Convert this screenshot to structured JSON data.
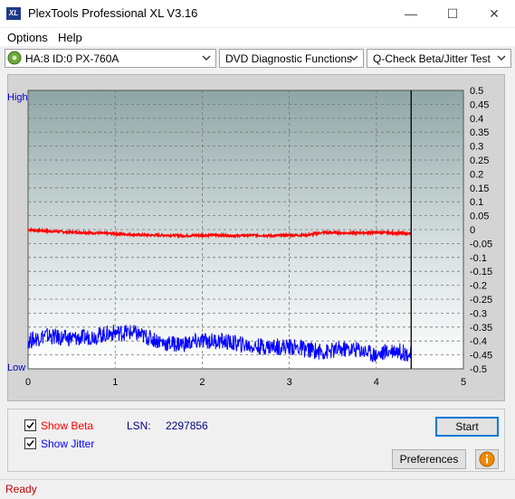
{
  "window": {
    "title": "PlexTools Professional XL V3.16",
    "icon_label": "XL"
  },
  "menu": [
    {
      "label": "Options"
    },
    {
      "label": "Help"
    }
  ],
  "toolbar": {
    "drive": "HA:8 ID:0  PX-760A",
    "function": "DVD Diagnostic Functions",
    "test": "Q-Check Beta/Jitter Test"
  },
  "chart": {
    "left_high": "High",
    "left_low": "Low",
    "x_ticks": [
      "0",
      "1",
      "2",
      "3",
      "4",
      "5"
    ],
    "right_ticks": [
      "0.5",
      "0.45",
      "0.4",
      "0.35",
      "0.3",
      "0.25",
      "0.2",
      "0.15",
      "0.1",
      "0.05",
      "0",
      "-0.05",
      "-0.1",
      "-0.15",
      "-0.2",
      "-0.25",
      "-0.3",
      "-0.35",
      "-0.4",
      "-0.45",
      "-0.5"
    ]
  },
  "chart_data": {
    "type": "line",
    "x_range": [
      0,
      5
    ],
    "y_range": [
      -0.5,
      0.5
    ],
    "grid": true,
    "marker_x": 4.4,
    "series": [
      {
        "color": "#ff0000",
        "x": [
          0,
          0.2,
          0.4,
          0.6,
          0.8,
          1.0,
          1.2,
          1.4,
          1.6,
          1.8,
          2.0,
          2.2,
          2.4,
          2.6,
          2.8,
          3.0,
          3.2,
          3.4,
          3.6,
          3.8,
          4.0,
          4.2,
          4.4
        ],
        "y": [
          0.0,
          -0.005,
          -0.008,
          -0.01,
          -0.012,
          -0.015,
          -0.018,
          -0.02,
          -0.02,
          -0.022,
          -0.02,
          -0.02,
          -0.022,
          -0.02,
          -0.022,
          -0.02,
          -0.02,
          -0.01,
          -0.012,
          -0.012,
          -0.01,
          -0.012,
          -0.015
        ]
      },
      {
        "color": "#0000ff",
        "x": [
          0,
          0.2,
          0.4,
          0.6,
          0.8,
          1.0,
          1.2,
          1.4,
          1.6,
          1.8,
          2.0,
          2.2,
          2.4,
          2.6,
          2.8,
          3.0,
          3.2,
          3.4,
          3.6,
          3.8,
          4.0,
          4.2,
          4.4
        ],
        "y": [
          -0.4,
          -0.38,
          -0.39,
          -0.39,
          -0.38,
          -0.37,
          -0.37,
          -0.39,
          -0.41,
          -0.41,
          -0.4,
          -0.4,
          -0.41,
          -0.42,
          -0.42,
          -0.42,
          -0.43,
          -0.44,
          -0.43,
          -0.43,
          -0.45,
          -0.43,
          -0.45
        ],
        "band": 0.03
      }
    ]
  },
  "options": {
    "show_beta": "Show Beta",
    "show_jitter": "Show Jitter",
    "beta_checked": true,
    "jitter_checked": true,
    "lsn_label": "LSN:",
    "lsn_value": "2297856"
  },
  "buttons": {
    "start": "Start",
    "preferences": "Preferences"
  },
  "status": {
    "text": "Ready"
  },
  "colors": {
    "beta": "#ff0000",
    "jitter": "#0000ff",
    "status_text": "#c00000"
  }
}
